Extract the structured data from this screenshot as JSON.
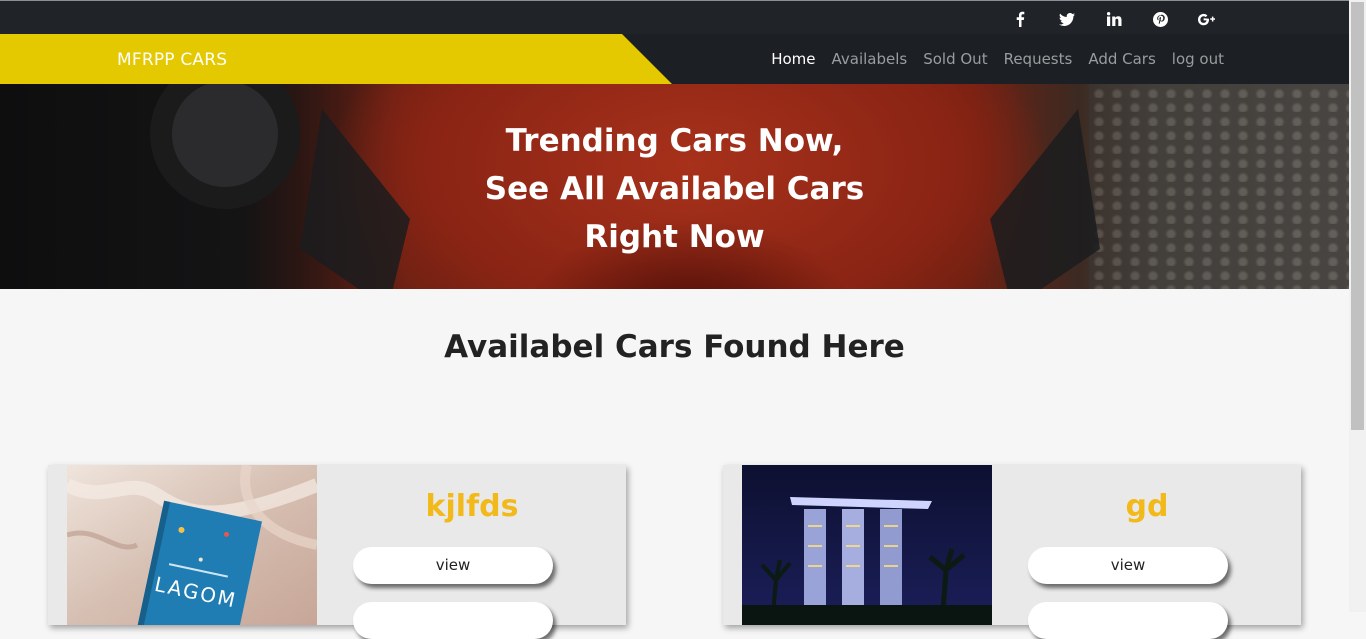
{
  "social": {
    "icons": [
      "facebook-icon",
      "twitter-icon",
      "linkedin-icon",
      "pinterest-icon",
      "google-plus-icon"
    ]
  },
  "navbar": {
    "brand": "MFRPP CARS",
    "links": [
      "Home",
      "Availabels",
      "Sold Out",
      "Requests",
      "Add Cars",
      "log out"
    ],
    "active": "Home"
  },
  "hero": {
    "lines": [
      "Trending Cars Now,",
      "See All Availabel Cars",
      "Right Now"
    ]
  },
  "section": {
    "title": "Availabel Cars Found Here"
  },
  "cards": [
    {
      "title": "kjlfds",
      "view_label": "view",
      "book_title": "LAGOM"
    },
    {
      "title": "gd",
      "view_label": "view"
    }
  ],
  "colors": {
    "brand_yellow": "#e4c800",
    "card_title": "#f2b91a",
    "navbar_bg": "#1c1f23"
  }
}
